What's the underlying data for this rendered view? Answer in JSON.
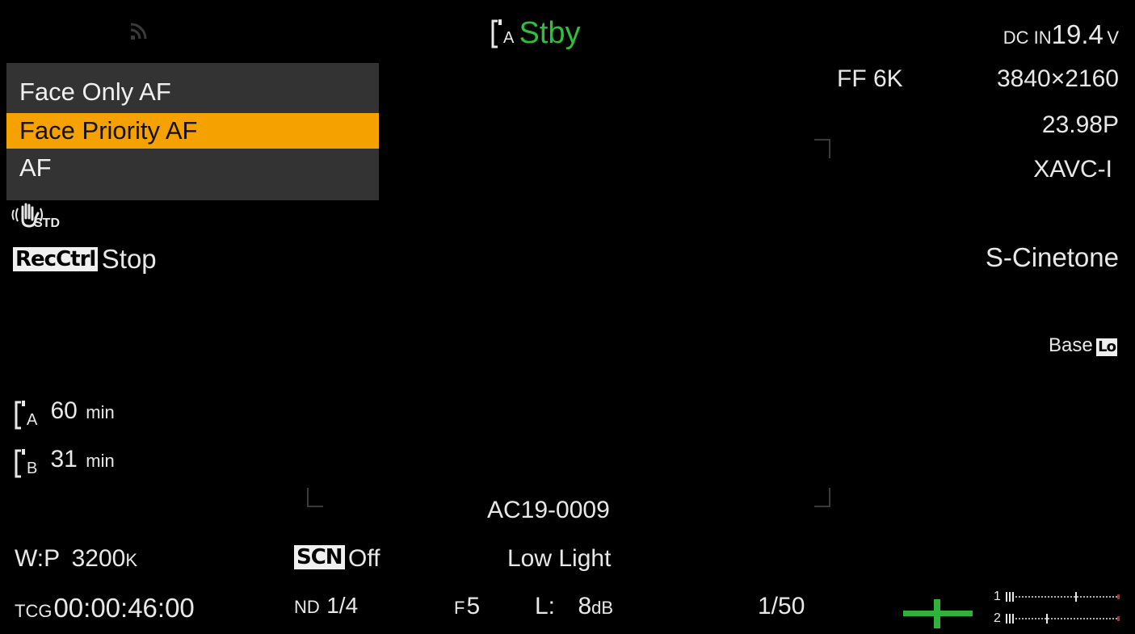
{
  "header": {
    "wifi_icon": "wifi-signal-icon",
    "slot_icon": "media-slot-icon",
    "slot_letter": "A",
    "status": "Stby",
    "status_color": "#2fbf3a",
    "power_label": "DC IN",
    "power_value": "19.4",
    "power_unit": "V"
  },
  "af_menu": {
    "items": [
      {
        "label": "Face Only AF",
        "selected": false
      },
      {
        "label": "Face Priority AF",
        "selected": true
      },
      {
        "label": "AF",
        "selected": false
      }
    ],
    "selected_color": "#f5a100"
  },
  "stabilizer": {
    "icon": "hand-shake-icon",
    "label": "STD"
  },
  "rec_ctrl": {
    "badge": "RecCtrl",
    "value": "Stop"
  },
  "format": {
    "imager": "FF 6K",
    "resolution": "3840×2160",
    "frame_rate": "23.98P",
    "codec": "XAVC-I"
  },
  "look": "S-Cinetone",
  "base_iso": {
    "label": "Base",
    "badge": "Lo"
  },
  "media": [
    {
      "slot": "A",
      "value": "60",
      "unit": "min"
    },
    {
      "slot": "B",
      "value": "31",
      "unit": "min"
    }
  ],
  "clip_name": "AC19-0009",
  "white_balance": {
    "label": "W:P",
    "value": "3200",
    "unit": "K"
  },
  "scene": {
    "badge": "SCN",
    "value": "Off"
  },
  "scene_mode": "Low Light",
  "timecode": {
    "label": "TCG",
    "value": "00:00:46:00"
  },
  "nd": {
    "label": "ND",
    "value": "1/4"
  },
  "iris": {
    "label": "F",
    "value": "5"
  },
  "gain": {
    "label": "L:",
    "value": "8",
    "unit": "dB"
  },
  "shutter": "1/50",
  "level_icon": "horizon-level-icon",
  "level_color": "#2fb33a",
  "audio": {
    "ch1": "1",
    "ch2": "2"
  }
}
